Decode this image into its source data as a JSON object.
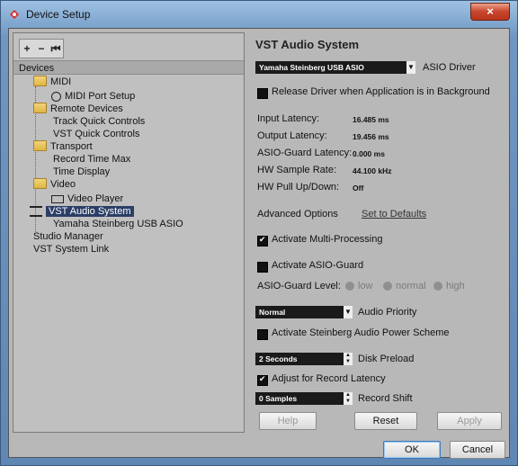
{
  "window": {
    "title": "Device Setup",
    "close_label": "×"
  },
  "toolbar": {
    "add": "+",
    "remove": "−",
    "reset": "⏮"
  },
  "devices": {
    "header": "Devices",
    "items": [
      {
        "label": "MIDI"
      },
      {
        "label": "MIDI Port Setup"
      },
      {
        "label": "Remote Devices"
      },
      {
        "label": "Track Quick Controls"
      },
      {
        "label": "VST Quick Controls"
      },
      {
        "label": "Transport"
      },
      {
        "label": "Record Time Max"
      },
      {
        "label": "Time Display"
      },
      {
        "label": "Video"
      },
      {
        "label": "Video Player"
      },
      {
        "label": "VST Audio System"
      },
      {
        "label": "Yamaha Steinberg USB ASIO"
      },
      {
        "label": "Studio Manager"
      },
      {
        "label": "VST System Link"
      }
    ]
  },
  "panel": {
    "title": "VST Audio System",
    "asio_driver_value": "Yamaha Steinberg USB ASIO",
    "asio_driver_label": "ASIO Driver",
    "release_driver_label": "Release Driver when Application is in Background",
    "input_latency_label": "Input Latency:",
    "input_latency_value": "16.485 ms",
    "output_latency_label": "Output Latency:",
    "output_latency_value": "19.456 ms",
    "asio_guard_latency_label": "ASIO-Guard Latency:",
    "asio_guard_latency_value": "0.000 ms",
    "hw_sample_rate_label": "HW Sample Rate:",
    "hw_sample_rate_value": "44.100 kHz",
    "hw_pull_label": "HW Pull Up/Down:",
    "hw_pull_value": "Off",
    "advanced_options": "Advanced Options",
    "set_defaults": "Set to Defaults",
    "multi_processing_label": "Activate Multi-Processing",
    "asio_guard_label": "Activate ASIO-Guard",
    "asio_guard_level_label": "ASIO-Guard Level:",
    "level_low": "low",
    "level_normal": "normal",
    "level_high": "high",
    "audio_priority_value": "Normal",
    "audio_priority_label": "Audio Priority",
    "power_scheme_label": "Activate Steinberg Audio Power Scheme",
    "disk_preload_value": "2 Seconds",
    "disk_preload_label": "Disk Preload",
    "record_latency_label": "Adjust for Record Latency",
    "record_shift_value": "0 Samples",
    "record_shift_label": "Record Shift"
  },
  "buttons": {
    "help": "Help",
    "reset": "Reset",
    "apply": "Apply",
    "ok": "OK",
    "cancel": "Cancel"
  }
}
